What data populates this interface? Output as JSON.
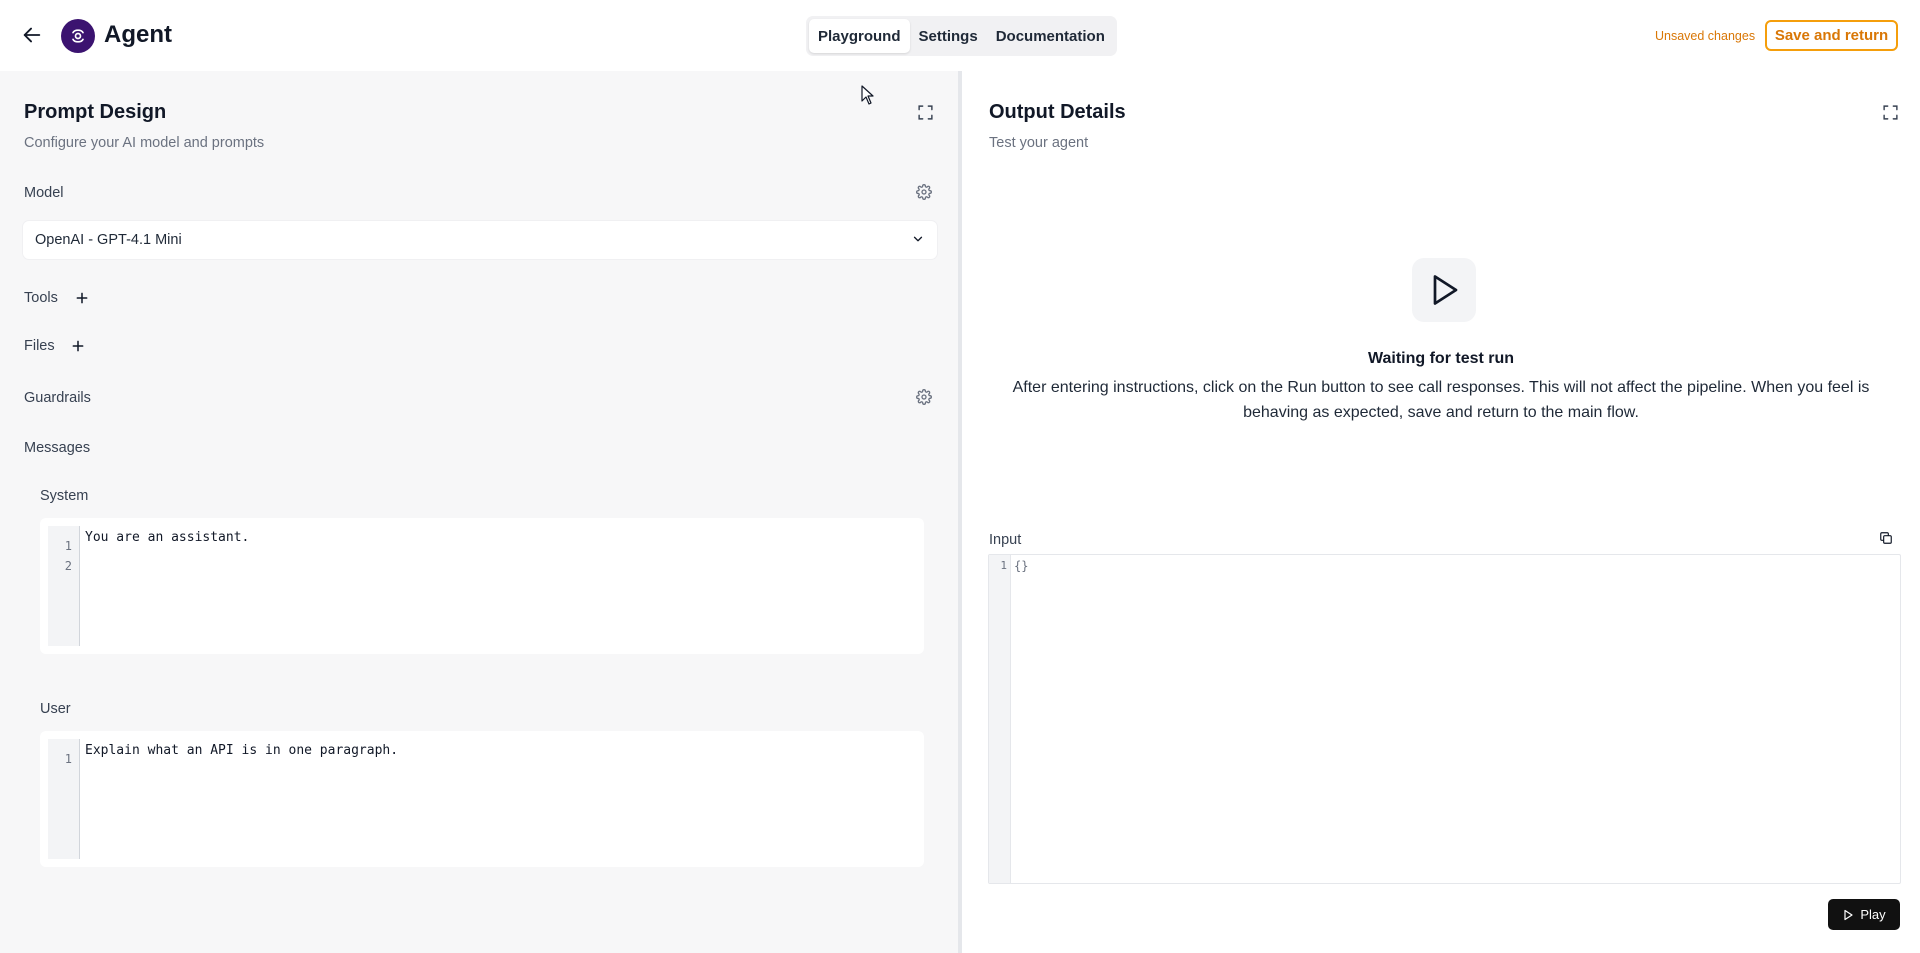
{
  "header": {
    "app_title": "Agent",
    "tabs": [
      {
        "label": "Playground",
        "active": true
      },
      {
        "label": "Settings",
        "active": false
      },
      {
        "label": "Documentation",
        "active": false
      }
    ],
    "unsaved_text": "Unsaved changes",
    "save_button": "Save and return"
  },
  "left": {
    "title": "Prompt Design",
    "subtitle": "Configure your AI model and prompts",
    "model_label": "Model",
    "model_value": "OpenAI - GPT-4.1 Mini",
    "tools_label": "Tools",
    "files_label": "Files",
    "guardrails_label": "Guardrails",
    "messages_label": "Messages",
    "system": {
      "label": "System",
      "lines": [
        "You are an assistant.",
        ""
      ],
      "line_numbers": [
        "1",
        "2"
      ]
    },
    "user": {
      "label": "User",
      "lines": [
        "Explain what an API is in one paragraph."
      ],
      "line_numbers": [
        "1"
      ]
    }
  },
  "right": {
    "title": "Output Details",
    "subtitle": "Test your agent",
    "waiting_title": "Waiting for test run",
    "waiting_text": "After entering instructions, click on the Run button to see call responses. This will not affect the pipeline. When you feel is behaving as expected, save and return to the main flow.",
    "input_label": "Input",
    "input_line_number": "1",
    "input_value": "{}",
    "play_button": "Play"
  },
  "colors": {
    "accent": "#f59e0b",
    "accent_text": "#d97706",
    "brand": "#3b1370",
    "left_bg": "#f7f7f8"
  },
  "icons": {
    "back": "arrow-left-icon",
    "logo": "swirl-logo-icon",
    "expand": "expand-icon",
    "gear": "gear-icon",
    "plus": "plus-icon",
    "chevron": "chevron-down-icon",
    "play": "play-icon",
    "copy": "copy-icon"
  }
}
